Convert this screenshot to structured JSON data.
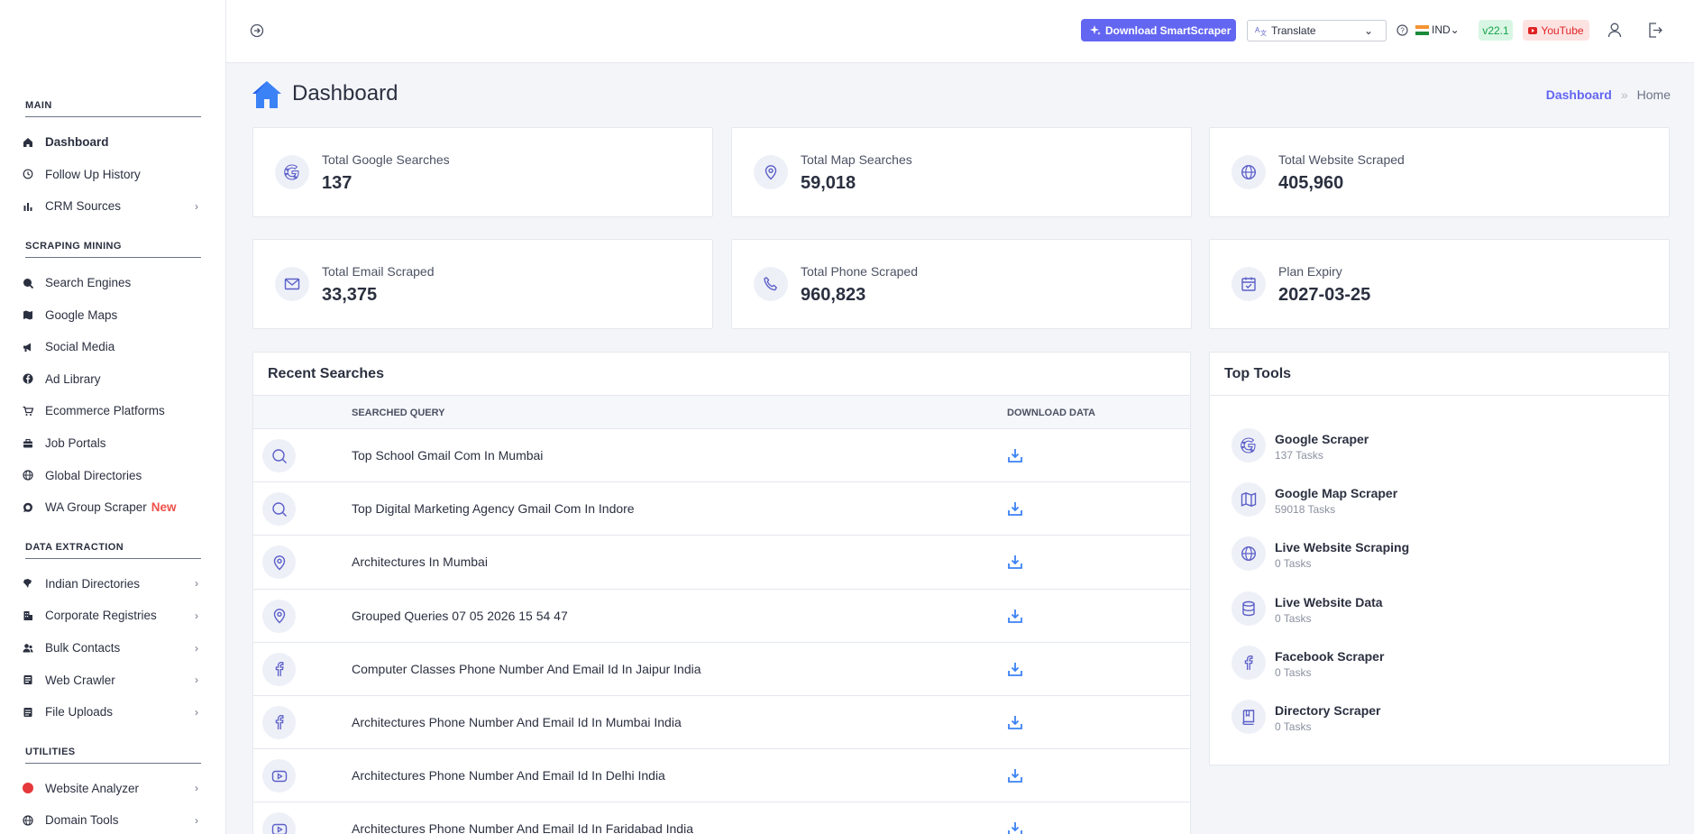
{
  "sidebar": {
    "sections": [
      {
        "title": "MAIN",
        "items": [
          {
            "label": "Dashboard",
            "icon": "home-icon",
            "active": true,
            "chevron": false
          },
          {
            "label": "Follow Up History",
            "icon": "history-icon",
            "chevron": false
          },
          {
            "label": "CRM Sources",
            "icon": "bar-chart-icon",
            "chevron": true
          }
        ]
      },
      {
        "title": "SCRAPING MINING",
        "items": [
          {
            "label": "Search Engines",
            "icon": "search-icon"
          },
          {
            "label": "Google Maps",
            "icon": "map-icon"
          },
          {
            "label": "Social Media",
            "icon": "megaphone-icon"
          },
          {
            "label": "Ad Library",
            "icon": "facebook-icon"
          },
          {
            "label": "Ecommerce Platforms",
            "icon": "cart-icon"
          },
          {
            "label": "Job Portals",
            "icon": "briefcase-icon"
          },
          {
            "label": "Global Directories",
            "icon": "globe-icon"
          },
          {
            "label": "WA Group Scraper",
            "badge": "New",
            "icon": "whatsapp-icon"
          }
        ]
      },
      {
        "title": "DATA EXTRACTION",
        "items": [
          {
            "label": "Indian Directories",
            "icon": "india-map-icon",
            "chevron": true
          },
          {
            "label": "Corporate Registries",
            "icon": "building-icon",
            "chevron": true
          },
          {
            "label": "Bulk Contacts",
            "icon": "users-icon",
            "chevron": true
          },
          {
            "label": "Web Crawler",
            "icon": "crawler-icon",
            "chevron": true
          },
          {
            "label": "File Uploads",
            "icon": "file-icon",
            "chevron": true
          }
        ]
      },
      {
        "title": "UTILITIES",
        "items": [
          {
            "label": "Website Analyzer",
            "icon": "red-dot-icon",
            "chevron": true
          },
          {
            "label": "Domain Tools",
            "icon": "globe-icon",
            "chevron": true
          }
        ]
      }
    ]
  },
  "topbar": {
    "download_label": "Download SmartScraper",
    "translate_label": "Translate",
    "country": "IND",
    "version": "v22.1",
    "youtube_label": "YouTube"
  },
  "page": {
    "title": "Dashboard",
    "breadcrumb": [
      "Dashboard",
      "Home"
    ],
    "breadcrumb_sep": "»"
  },
  "stats": [
    {
      "label": "Total Google Searches",
      "value": "137",
      "icon": "google-icon"
    },
    {
      "label": "Total Map Searches",
      "value": "59,018",
      "icon": "map-pin-icon"
    },
    {
      "label": "Total Website Scraped",
      "value": "405,960",
      "icon": "globe-icon"
    },
    {
      "label": "Total Email Scraped",
      "value": "33,375",
      "icon": "mail-icon"
    },
    {
      "label": "Total Phone Scraped",
      "value": "960,823",
      "icon": "phone-icon"
    },
    {
      "label": "Plan Expiry",
      "value": "2027-03-25",
      "icon": "calendar-icon"
    }
  ],
  "recent": {
    "title": "Recent Searches",
    "col_query": "SEARCHED QUERY",
    "col_download": "DOWNLOAD DATA",
    "rows": [
      {
        "icon": "search-icon",
        "query": "Top School Gmail Com In Mumbai"
      },
      {
        "icon": "search-icon",
        "query": "Top Digital Marketing Agency Gmail Com In Indore"
      },
      {
        "icon": "map-pin-icon",
        "query": "Architectures In Mumbai"
      },
      {
        "icon": "map-pin-icon",
        "query": "Grouped Queries 07 05 2026 15 54 47"
      },
      {
        "icon": "facebook-icon",
        "query": "Computer Classes Phone Number And Email Id In Jaipur India"
      },
      {
        "icon": "facebook-icon",
        "query": "Architectures Phone Number And Email Id In Mumbai India"
      },
      {
        "icon": "youtube-icon",
        "query": "Architectures Phone Number And Email Id In Delhi India"
      },
      {
        "icon": "youtube-icon",
        "query": "Architectures Phone Number And Email Id In Faridabad India"
      }
    ]
  },
  "tools": {
    "title": "Top Tools",
    "items": [
      {
        "name": "Google Scraper",
        "count": "137 Tasks",
        "icon": "google-icon"
      },
      {
        "name": "Google Map Scraper",
        "count": "59018 Tasks",
        "icon": "map-icon"
      },
      {
        "name": "Live Website Scraping",
        "count": "0 Tasks",
        "icon": "globe-icon"
      },
      {
        "name": "Live Website Data",
        "count": "0 Tasks",
        "icon": "database-icon"
      },
      {
        "name": "Facebook Scraper",
        "count": "0 Tasks",
        "icon": "facebook-icon"
      },
      {
        "name": "Directory Scraper",
        "count": "0 Tasks",
        "icon": "book-icon"
      }
    ]
  },
  "colors": {
    "accent": "#6366f1",
    "icon": "#5b5fc7",
    "youtube": "#e02424",
    "version": "#16a34a"
  }
}
